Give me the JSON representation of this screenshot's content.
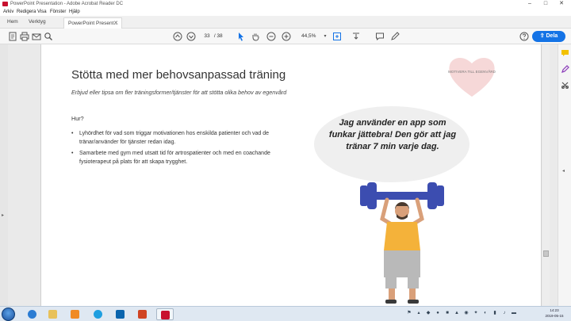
{
  "window": {
    "title": "PowerPoint Presentation - Adobe Acrobat Reader DC",
    "controls": [
      "–",
      "□",
      "✕"
    ]
  },
  "menu": {
    "items": [
      "Arkiv",
      "Redigera",
      "Visa",
      "Fönster",
      "Hjälp"
    ]
  },
  "tabs": {
    "home": "Hem",
    "tools": "Verktyg",
    "doc": "PowerPoint Present..."
  },
  "toolbar": {
    "page_current": "33",
    "page_total": "/ 38",
    "zoom": "44,5%",
    "share_label": "Dela"
  },
  "slide": {
    "title": "Stötta med mer behovsanpassad träning",
    "subtitle": "Erbjud eller tipsa om fler träningsformer/tjänster för att stötta olika behov av egenvård",
    "hur": "Hur?",
    "bullets": [
      "Lyhördhet för vad som triggar motivationen hos enskilda patienter och vad de tränar/använder för tjänster redan idag.",
      "Samarbete med gym med utsatt tid för artrospatienter och med en coachande fysioterapeut på plats för att skapa trygghet."
    ],
    "heart_text": "MOTIVERA TILL EGENVÅRD",
    "quote": "Jag använder en app som funkar jättebra! Den gör att jag tränar 7 min varje dag."
  },
  "taskbar": {
    "clock_time": "14:23",
    "clock_date": "2019-05-15"
  },
  "colors": {
    "accent": "#1473e6",
    "heart": "#f6d8d8",
    "bubble": "#efefef",
    "barbell": "#3c4db0",
    "shirt": "#f4b23a",
    "pants": "#b9b9b9"
  }
}
